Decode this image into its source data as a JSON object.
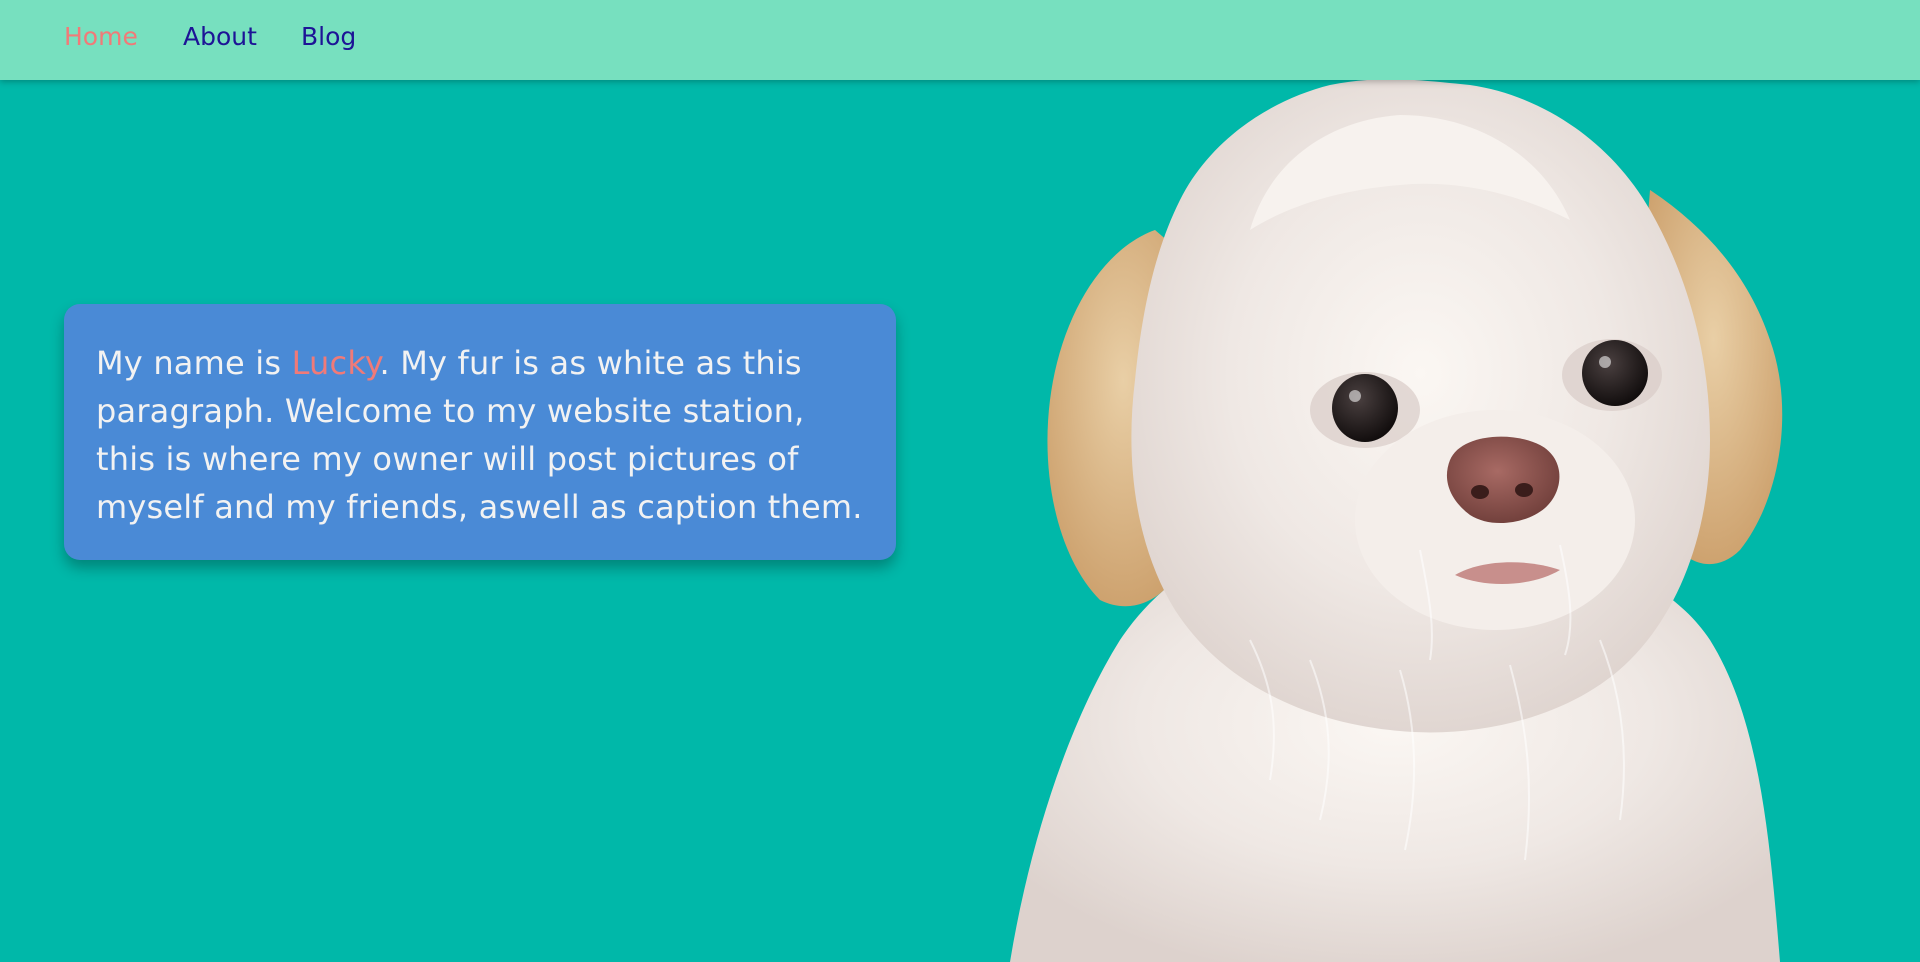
{
  "nav": {
    "home_label": "Home",
    "about_label": "About",
    "blog_label": "Blog",
    "active": "Home"
  },
  "intro": {
    "prefix": "My name is ",
    "name": "Lucky",
    "suffix": ". My fur is as white as this paragraph. Welcome to my website station, this is where my owner will post pictures of myself and my friends, aswell as caption them."
  },
  "hero_image": {
    "subject": "white fluffy puppy with tan ears"
  },
  "colors": {
    "page_background": "#00b8a9",
    "navbar_background": "#77e0bf",
    "nav_link": "#1d1496",
    "nav_link_active": "#f07a78",
    "card_background": "#4a8ad6",
    "card_text": "#f2f2f2",
    "name_highlight": "#f07a78"
  }
}
